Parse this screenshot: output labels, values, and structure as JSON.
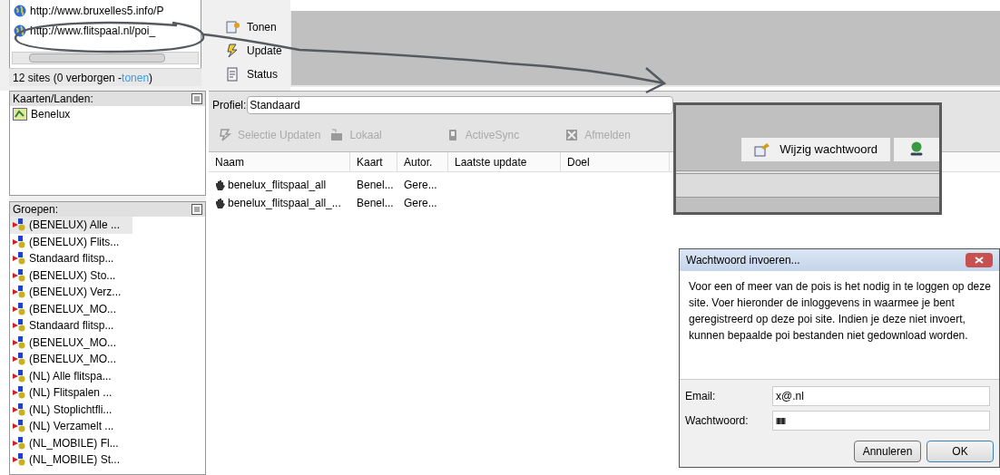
{
  "sites": {
    "items": [
      {
        "url": "http://www.bruxelles5.info/P"
      },
      {
        "url": "http://www.flitspaal.nl/poi_"
      }
    ],
    "status": "12 sites (0 verborgen - ",
    "status_link": "tonen",
    "status_end": ")"
  },
  "side_toolbar": [
    {
      "label": "Tonen"
    },
    {
      "label": "Update"
    },
    {
      "label": "Status"
    }
  ],
  "kaarten": {
    "title": "Kaarten/Landen:",
    "items": [
      {
        "label": "Benelux"
      }
    ]
  },
  "groepen": {
    "title": "Groepen:",
    "items": [
      {
        "label": "(BENELUX) Alle ...",
        "selected": true
      },
      {
        "label": "(BENELUX) Flits...",
        "selected": false
      },
      {
        "label": "Standaard flitsp...",
        "selected": false
      },
      {
        "label": "(BENELUX) Sto...",
        "selected": false
      },
      {
        "label": "(BENELUX) Verz...",
        "selected": false
      },
      {
        "label": "(BENELUX_MO...",
        "selected": false
      },
      {
        "label": "Standaard flitsp...",
        "selected": false
      },
      {
        "label": "(BENELUX_MO...",
        "selected": false
      },
      {
        "label": "(BENELUX_MO...",
        "selected": false
      },
      {
        "label": "(NL) Alle flitspa...",
        "selected": false
      },
      {
        "label": "(NL) Flitspalen ...",
        "selected": false
      },
      {
        "label": "(NL) Stoplichtfli...",
        "selected": false
      },
      {
        "label": "(NL) Verzamelt ...",
        "selected": false
      },
      {
        "label": "(NL_MOBILE) Fl...",
        "selected": false
      },
      {
        "label": "(NL_MOBILE) St...",
        "selected": false
      }
    ]
  },
  "profile": {
    "label": "Profiel:",
    "value": "Standaard"
  },
  "toolbar": [
    {
      "label": "Selectie Updaten",
      "disabled": true
    },
    {
      "label": "Lokaal",
      "disabled": true
    },
    {
      "label": "ActiveSync",
      "disabled": true
    },
    {
      "label": "Afmelden",
      "disabled": true
    }
  ],
  "account_buttons": {
    "change_password": "Wijzig wachtwoord"
  },
  "table": {
    "columns": [
      "Naam",
      "Kaart",
      "Autor.",
      "Laatste update",
      "Doel"
    ],
    "rows": [
      [
        "benelux_flitspaal_all",
        "Benel...",
        "Gere..."
      ],
      [
        "benelux_flitspaal_all_...",
        "Benel...",
        "Gere..."
      ]
    ]
  },
  "dialog": {
    "title": "Wachtwoord invoeren...",
    "message": "Voor een of meer van de pois is het nodig in te loggen op deze site. Voer hieronder de inloggevens in waarmee je bent geregistreerd op deze poi site. Indien je deze niet invoert, kunnen bepaalde poi bestanden niet gedownload worden.",
    "fields": [
      {
        "label": "Email:",
        "value": "x@.nl",
        "kind": "text"
      },
      {
        "label": "Wachtwoord:",
        "value": "||||||||",
        "kind": "password"
      }
    ],
    "buttons": [
      {
        "label": "Annuleren",
        "default": false
      },
      {
        "label": "OK",
        "default": true
      }
    ]
  }
}
